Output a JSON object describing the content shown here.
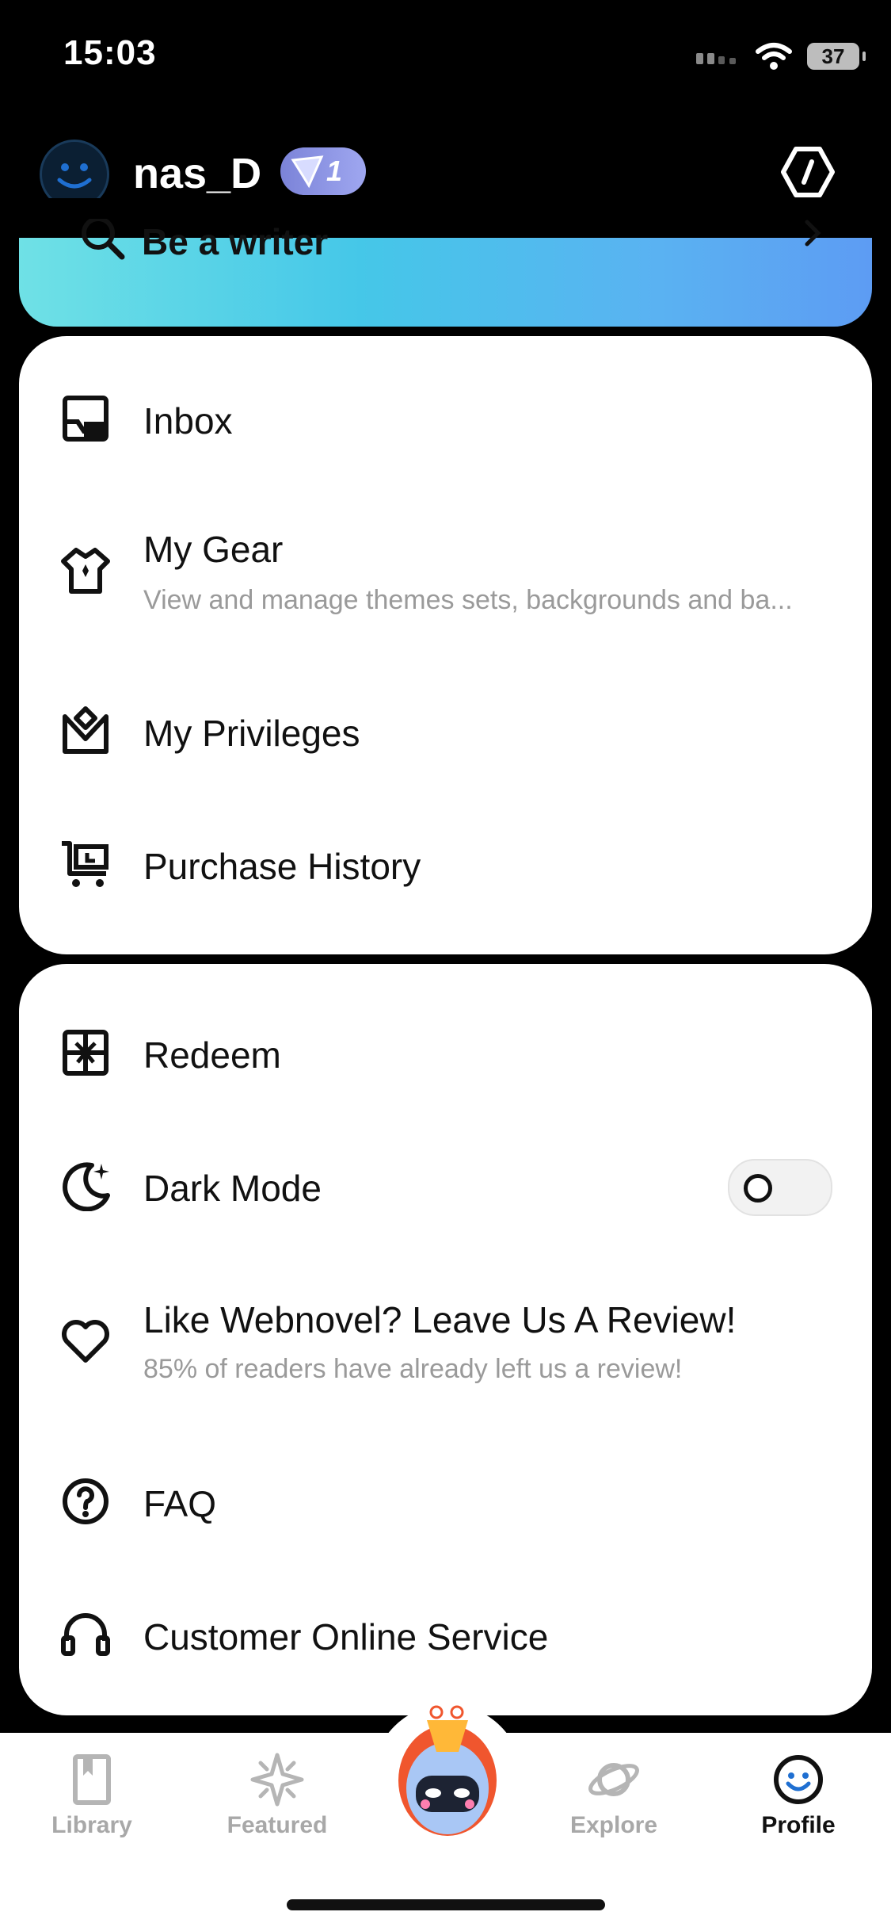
{
  "status": {
    "time": "15:03",
    "battery": "37"
  },
  "profile": {
    "username": "nas_D",
    "level": "1"
  },
  "writer_banner": {
    "label": "Be a writer"
  },
  "menu_card_1": [
    {
      "label": "Inbox",
      "icon": "inbox-icon"
    },
    {
      "label": "My Gear",
      "sub": "View and manage themes sets, backgrounds and ba...",
      "icon": "shirt-icon"
    },
    {
      "label": "My Privileges",
      "icon": "crown-icon"
    },
    {
      "label": "Purchase History",
      "icon": "cart-icon"
    }
  ],
  "menu_card_2": [
    {
      "label": "Redeem",
      "icon": "gift-icon"
    },
    {
      "label": "Dark Mode",
      "icon": "moon-icon",
      "toggle": false
    },
    {
      "label": "Like Webnovel? Leave Us A Review!",
      "sub": "85% of readers have already left us a review!",
      "icon": "heart-icon"
    },
    {
      "label": "FAQ",
      "icon": "question-icon"
    },
    {
      "label": "Customer Online Service",
      "icon": "headset-icon"
    }
  ],
  "tabs": [
    {
      "label": "Library",
      "icon": "book-icon",
      "active": false
    },
    {
      "label": "Featured",
      "icon": "sparkle-icon",
      "active": false
    },
    {
      "label": "Explore",
      "icon": "planet-icon",
      "active": false
    },
    {
      "label": "Profile",
      "icon": "smiley-icon",
      "active": true
    }
  ],
  "colors": {
    "background": "#000000",
    "card": "#ffffff",
    "banner_start": "#6fe1e6",
    "banner_end": "#5d9cf3",
    "badge": "#8c94e4"
  }
}
